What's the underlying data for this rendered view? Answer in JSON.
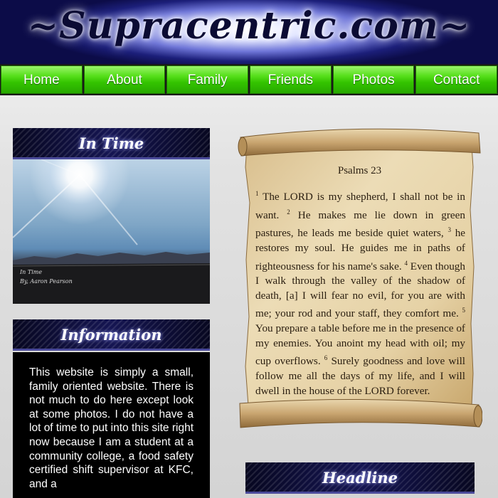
{
  "header": {
    "site_title": "~Supracentric.com~"
  },
  "nav": {
    "items": [
      {
        "label": "Home"
      },
      {
        "label": "About"
      },
      {
        "label": "Family"
      },
      {
        "label": "Friends"
      },
      {
        "label": "Photos"
      },
      {
        "label": "Contact"
      }
    ]
  },
  "in_time": {
    "heading": "In Time",
    "caption_line1": "In Time",
    "caption_line2": "By, Aaron Pearson"
  },
  "information": {
    "heading": "Information",
    "text": "This website is simply a small, family oriented website. There is not much to do here except look at some photos. I do not have a lot of time to put into this site right now because I am a student at a community college, a food safety certified shift supervisor at KFC, and a"
  },
  "scroll": {
    "title": "Psalms 23",
    "verses": [
      {
        "num": "1",
        "text": "The LORD is my shepherd, I shall not be in want."
      },
      {
        "num": "2",
        "text": "He makes me lie down in green pastures, he leads me beside quiet waters,"
      },
      {
        "num": "3",
        "text": "he restores my soul. He guides me in paths of righteousness for his name's sake."
      },
      {
        "num": "4",
        "text": "Even though I walk through the valley of the shadow of death, [a] I will fear no evil, for you are with me; your rod and your staff, they comfort me."
      },
      {
        "num": "5",
        "text": "You prepare a table before me in the presence of my enemies. You anoint my head with oil; my cup overflows."
      },
      {
        "num": "6",
        "text": "Surely goodness and love will follow me all the days of my life, and I will dwell in the house of the LORD forever."
      }
    ]
  },
  "headline": {
    "heading": "Headline"
  }
}
